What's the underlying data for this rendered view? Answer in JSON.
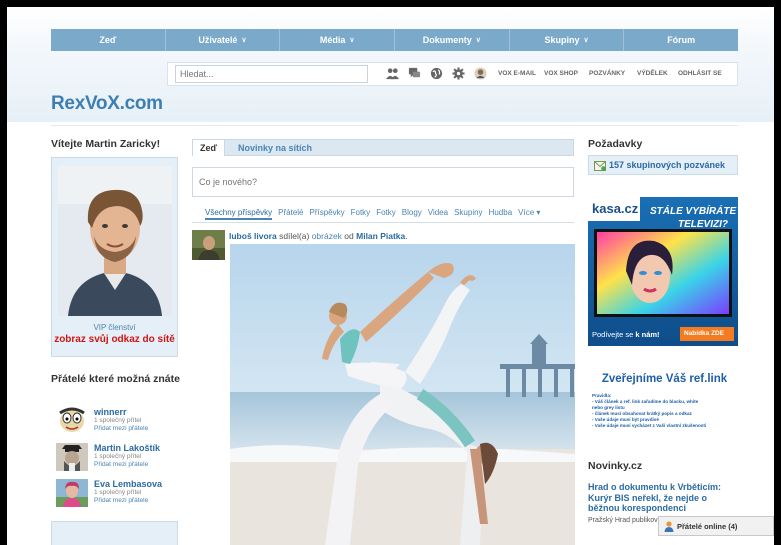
{
  "nav": {
    "items": [
      {
        "label": "Zeď",
        "chevron": false
      },
      {
        "label": "Uživatelé",
        "chevron": true
      },
      {
        "label": "Média",
        "chevron": true
      },
      {
        "label": "Dokumenty",
        "chevron": true
      },
      {
        "label": "Skupiny",
        "chevron": true
      },
      {
        "label": "Fórum",
        "chevron": false
      }
    ]
  },
  "toolbar": {
    "search_placeholder": "Hledat...",
    "icons": [
      "users-icon",
      "chat-icon",
      "globe-icon",
      "gear-icon",
      "profile-icon"
    ],
    "links": [
      "VOX E-MAIL",
      "VOX SHOP",
      "POZVÁNKY",
      "VÝDĚLEK",
      "ODHLÁSIT SE"
    ]
  },
  "logo": "RexVoX.com",
  "left": {
    "welcome": "Vítejte Martin Zaricky!",
    "vip": "VIP členství",
    "show_link": "zobraz svůj odkaz do sítě",
    "friends_heading": "Přátelé které možná znáte",
    "friends": [
      {
        "name": "winnerr",
        "mutual": "1 společný přítel",
        "add": "Přidat mezi přátele"
      },
      {
        "name": "Martin Lakoštík",
        "mutual": "1 společný přítel",
        "add": "Přidat mezi přátele"
      },
      {
        "name": "Eva Lembasova",
        "mutual": "1 společný přítel",
        "add": "Přidat mezi přátele"
      }
    ]
  },
  "center": {
    "tabs": [
      "Zeď",
      "Novinky na sítích"
    ],
    "status_placeholder": "Co je nového?",
    "filters": [
      "Všechny příspěvky",
      "Přátelé",
      "Příspěvky",
      "Fotky",
      "Fotky",
      "Blogy",
      "Videa",
      "Skupiny",
      "Hudba",
      "Více ▾"
    ],
    "post": {
      "author": "luboš livora",
      "action": " sdílel(a) ",
      "object": "obrázek",
      "from": " od ",
      "source": "Milan Piatka",
      "end": "."
    }
  },
  "right": {
    "requests_heading": "Požadavky",
    "invites": "157 skupinových pozvánek",
    "ad": {
      "brand": "kasa.cz",
      "line1": "STÁLE VYBÍRÁTE",
      "line2": "TELEVIZI?",
      "cta_text": "Podívejte se ",
      "cta_bold": "k nám!",
      "button": "Nabídka ZDE"
    },
    "reflink_heading": "Zveřejníme Váš ref.link",
    "rules": [
      "Pravidla:",
      "- Váš článek a ref. link zařadíme do blacku, white",
      "nebo grey listu",
      "- článek musí obsahovat krátký popis a odkaz",
      "- Vaše údaje musí být pravdivé",
      "- Vaše údaje musí vycházet z Vaší vlastní zkušenosti"
    ],
    "news_heading": "Novinky.cz",
    "news_title": "Hrad o dokumentu k Vrběticím: Kurýr BIS neřekl, že nejde o běžnou korespondenci",
    "news_body": "Pražský Hrad publikov webu obsáhlé vyjádře",
    "online": "Přátelé online (4)"
  },
  "colors": {
    "nav_bg": "#7aa9ca",
    "link": "#2b6aa3",
    "logo": "#3d7fb3",
    "vip_link": "#d21414",
    "box_bg": "#e5eff7"
  }
}
